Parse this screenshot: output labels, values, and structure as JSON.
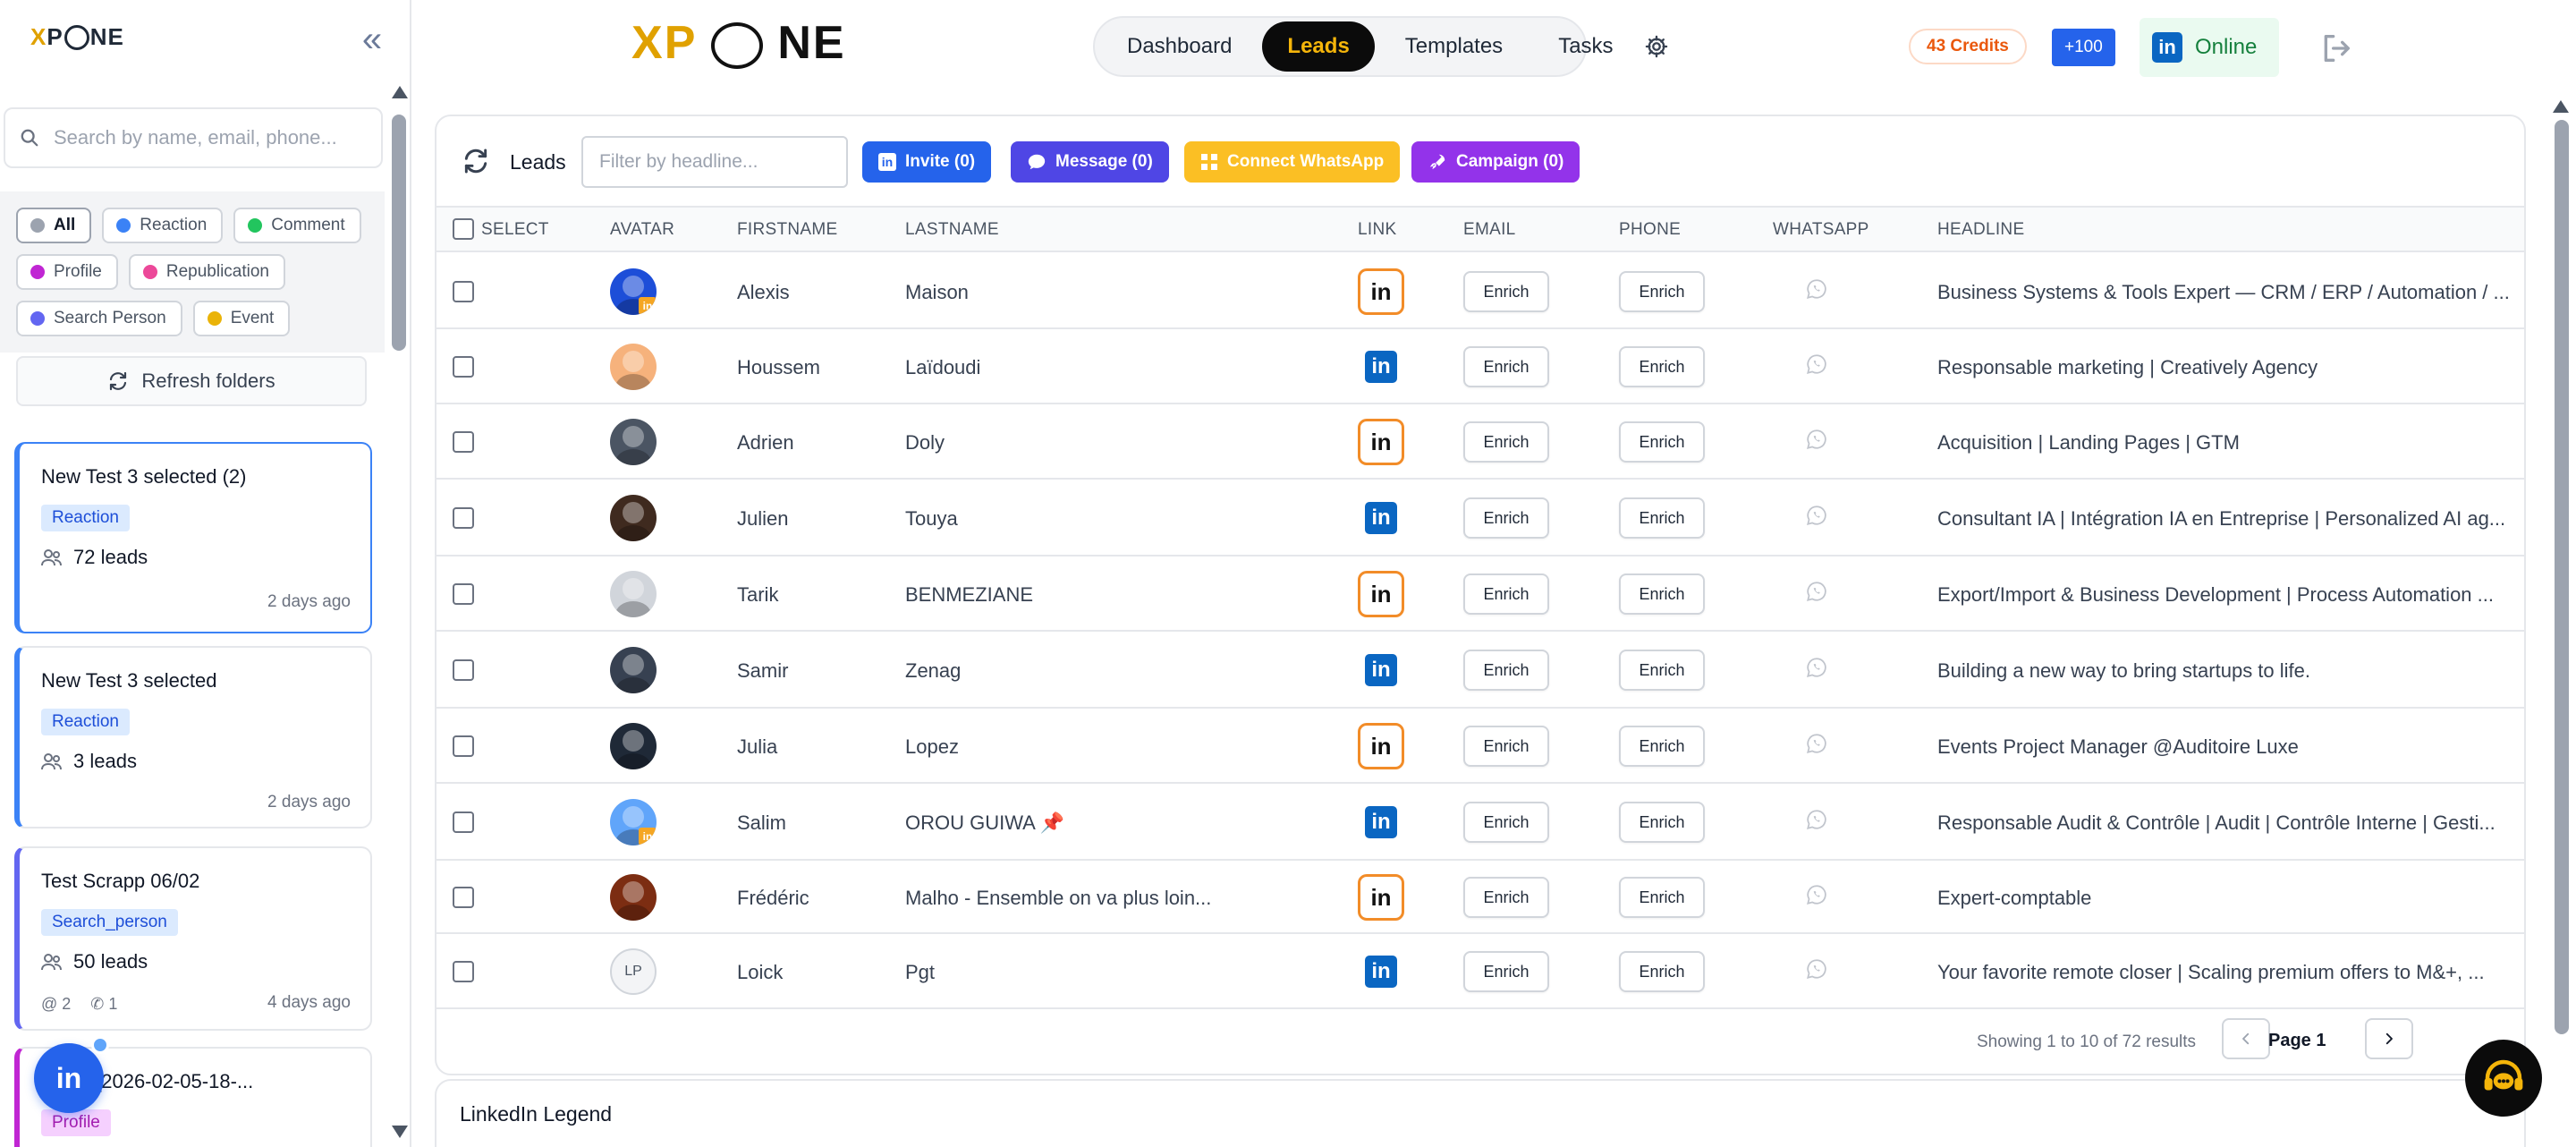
{
  "sidebar": {
    "logo": "XPONE",
    "search_placeholder": "Search by name, email, phone...",
    "filters": [
      {
        "label": "All",
        "color": "#9ca3af",
        "active": true
      },
      {
        "label": "Reaction",
        "color": "#3b82f6"
      },
      {
        "label": "Comment",
        "color": "#22c55e"
      },
      {
        "label": "Profile",
        "color": "#c026d3"
      },
      {
        "label": "Republication",
        "color": "#ec4899"
      },
      {
        "label": "Search Person",
        "color": "#6366f1"
      },
      {
        "label": "Event",
        "color": "#eab308"
      }
    ],
    "refresh_label": "Refresh folders",
    "folders": [
      {
        "title": "New Test 3 selected (2)",
        "badge": "Reaction",
        "leads": "72 leads",
        "time": "2 days ago"
      },
      {
        "title": "New Test 3 selected",
        "badge": "Reaction",
        "leads": "3 leads",
        "time": "2 days ago"
      },
      {
        "title": "Test Scrapp 06/02",
        "badge": "Search_person",
        "leads": "50 leads",
        "time": "4 days ago",
        "mentions": "2",
        "calls": "1"
      },
      {
        "title": "s_2026-02-05-18-...",
        "badge": "Profile"
      }
    ],
    "fab_label": "in"
  },
  "nav": {
    "logo": "XPONE",
    "items": [
      "Dashboard",
      "Leads",
      "Templates",
      "Tasks"
    ],
    "active": "Leads",
    "credits": "43 Credits",
    "plus": "+100",
    "status": "Online"
  },
  "leads": {
    "title": "Leads",
    "filter_placeholder": "Filter by headline...",
    "buttons": {
      "invite": "Invite (0)",
      "message": "Message (0)",
      "whatsapp": "Connect WhatsApp",
      "campaign": "Campaign (0)"
    },
    "colors": {
      "invite": "#2563eb",
      "message": "#4f46e5",
      "whatsapp": "#fbbf24",
      "campaign": "#9333ea"
    },
    "columns": {
      "select": "SELECT",
      "avatar": "AVATAR",
      "firstname": "FIRSTNAME",
      "lastname": "LASTNAME",
      "link": "LINK",
      "email": "EMAIL",
      "phone": "PHONE",
      "whatsapp": "WHATSAPP",
      "headline": "HEADLINE"
    },
    "enrich_label": "Enrich",
    "rows": [
      {
        "firstname": "Alexis",
        "lastname": "Maison",
        "link": "outline",
        "headline": "Business Systems & Tools Expert — CRM / ERP / Automation / ...",
        "avatar_color": "#1d4ed8",
        "avatar_badge": true
      },
      {
        "firstname": "Houssem",
        "lastname": "Laïdoudi",
        "link": "filled",
        "headline": "Responsable marketing | Creatively Agency",
        "avatar_color": "#f6b27c"
      },
      {
        "firstname": "Adrien",
        "lastname": "Doly",
        "link": "outline",
        "headline": "Acquisition | Landing Pages | GTM",
        "avatar_color": "#4b5563"
      },
      {
        "firstname": "Julien",
        "lastname": "Touya",
        "link": "filled",
        "headline": "Consultant IA | Intégration IA en Entreprise | Personalized AI ag...",
        "avatar_color": "#3f2a1f"
      },
      {
        "firstname": "Tarik",
        "lastname": "BENMEZIANE",
        "link": "outline",
        "headline": "Export/Import & Business Development | Process Automation ...",
        "avatar_color": "#d1d5db"
      },
      {
        "firstname": "Samir",
        "lastname": "Zenag",
        "link": "filled",
        "headline": "Building a new way to bring startups to life.",
        "avatar_color": "#374151"
      },
      {
        "firstname": "Julia",
        "lastname": "Lopez",
        "link": "outline",
        "headline": "Events Project Manager @Auditoire Luxe",
        "avatar_color": "#1f2937"
      },
      {
        "firstname": "Salim",
        "lastname": "OROU GUIWA",
        "pin": "📌",
        "link": "filled",
        "headline": "Responsable Audit & Contrôle | Audit | Contrôle Interne | Gesti...",
        "avatar_color": "#60a5fa",
        "avatar_badge": true
      },
      {
        "firstname": "Frédéric",
        "lastname": "Malho - Ensemble on va plus loin...",
        "link": "outline",
        "headline": "Expert-comptable",
        "avatar_color": "#7c2d12"
      },
      {
        "firstname": "Loick",
        "lastname": "Pgt",
        "link": "filled",
        "headline": "Your favorite remote closer | Scaling premium offers to M&+, ...",
        "avatar_initials": "LP"
      }
    ],
    "pagination": {
      "showing": "Showing 1 to 10 of 72 results",
      "page": "Page 1"
    },
    "legend_title": "LinkedIn Legend"
  }
}
